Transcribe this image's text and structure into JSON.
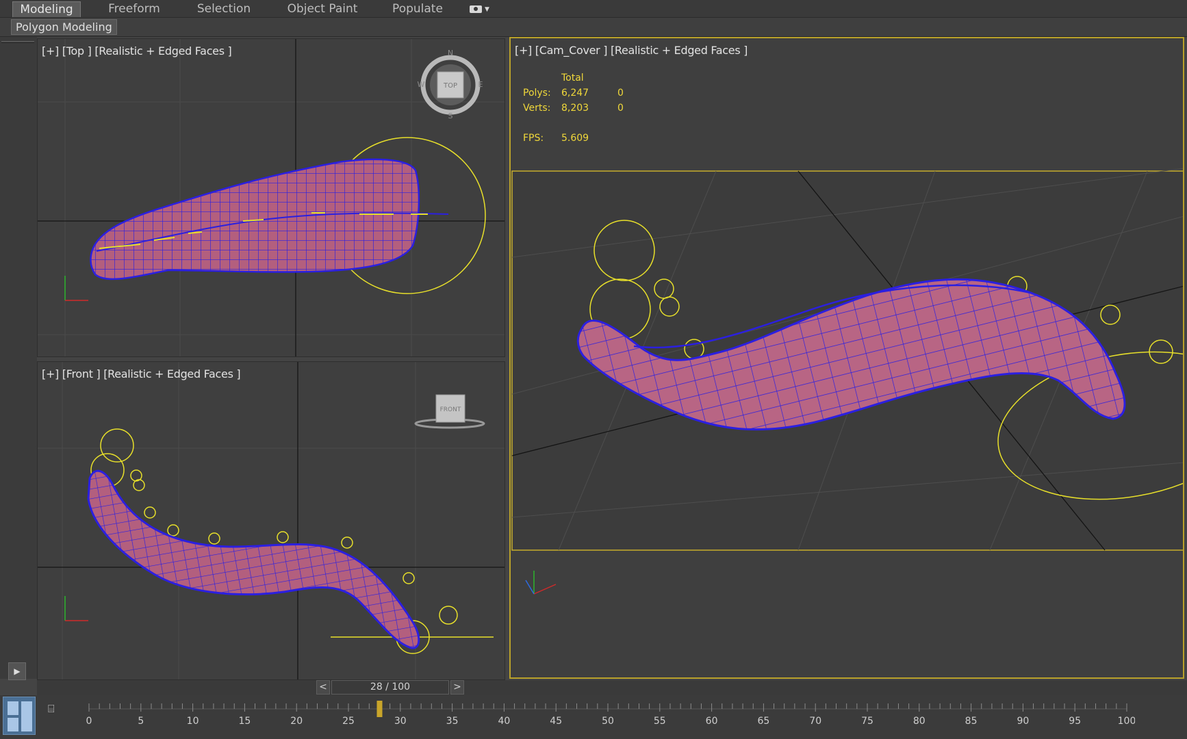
{
  "ribbon": {
    "tabs": [
      {
        "label": "Modeling",
        "active": true
      },
      {
        "label": "Freeform",
        "active": false
      },
      {
        "label": "Selection",
        "active": false
      },
      {
        "label": "Object Paint",
        "active": false
      },
      {
        "label": "Populate",
        "active": false
      }
    ],
    "more_icon": "camera-icon",
    "panel_label": "Polygon Modeling"
  },
  "viewports": {
    "top": {
      "label": "[+] [Top ] [Realistic + Edged Faces ]",
      "viewcube_face": "TOP",
      "compass": {
        "n": "N",
        "s": "S",
        "e": "E",
        "w": "W"
      }
    },
    "front": {
      "label": "[+] [Front ] [Realistic + Edged Faces ]",
      "viewcube_face": "FRONT"
    },
    "camera": {
      "label": "[+] [Cam_Cover ] [Realistic + Edged Faces ]",
      "stats": {
        "header": "Total",
        "polys_label": "Polys:",
        "polys_total": "6,247",
        "polys_sel": "0",
        "verts_label": "Verts:",
        "verts_total": "8,203",
        "verts_sel": "0",
        "fps_label": "FPS:",
        "fps_value": "5.609"
      }
    }
  },
  "time_slider": {
    "prev": "<",
    "frame": "28 / 100",
    "next": ">",
    "current": 28,
    "total": 100
  },
  "trackbar": {
    "labels": [
      "0",
      "5",
      "10",
      "15",
      "20",
      "25",
      "30",
      "35",
      "40",
      "45",
      "50",
      "55",
      "60",
      "65",
      "70",
      "75",
      "80",
      "85",
      "90",
      "95",
      "100"
    ]
  },
  "colors": {
    "active_border": "#b9a12a",
    "stat_text": "#f0d83a",
    "wire": "#2b1fe0",
    "mesh": "#b0607e",
    "gizmo": "#e8e02a"
  }
}
